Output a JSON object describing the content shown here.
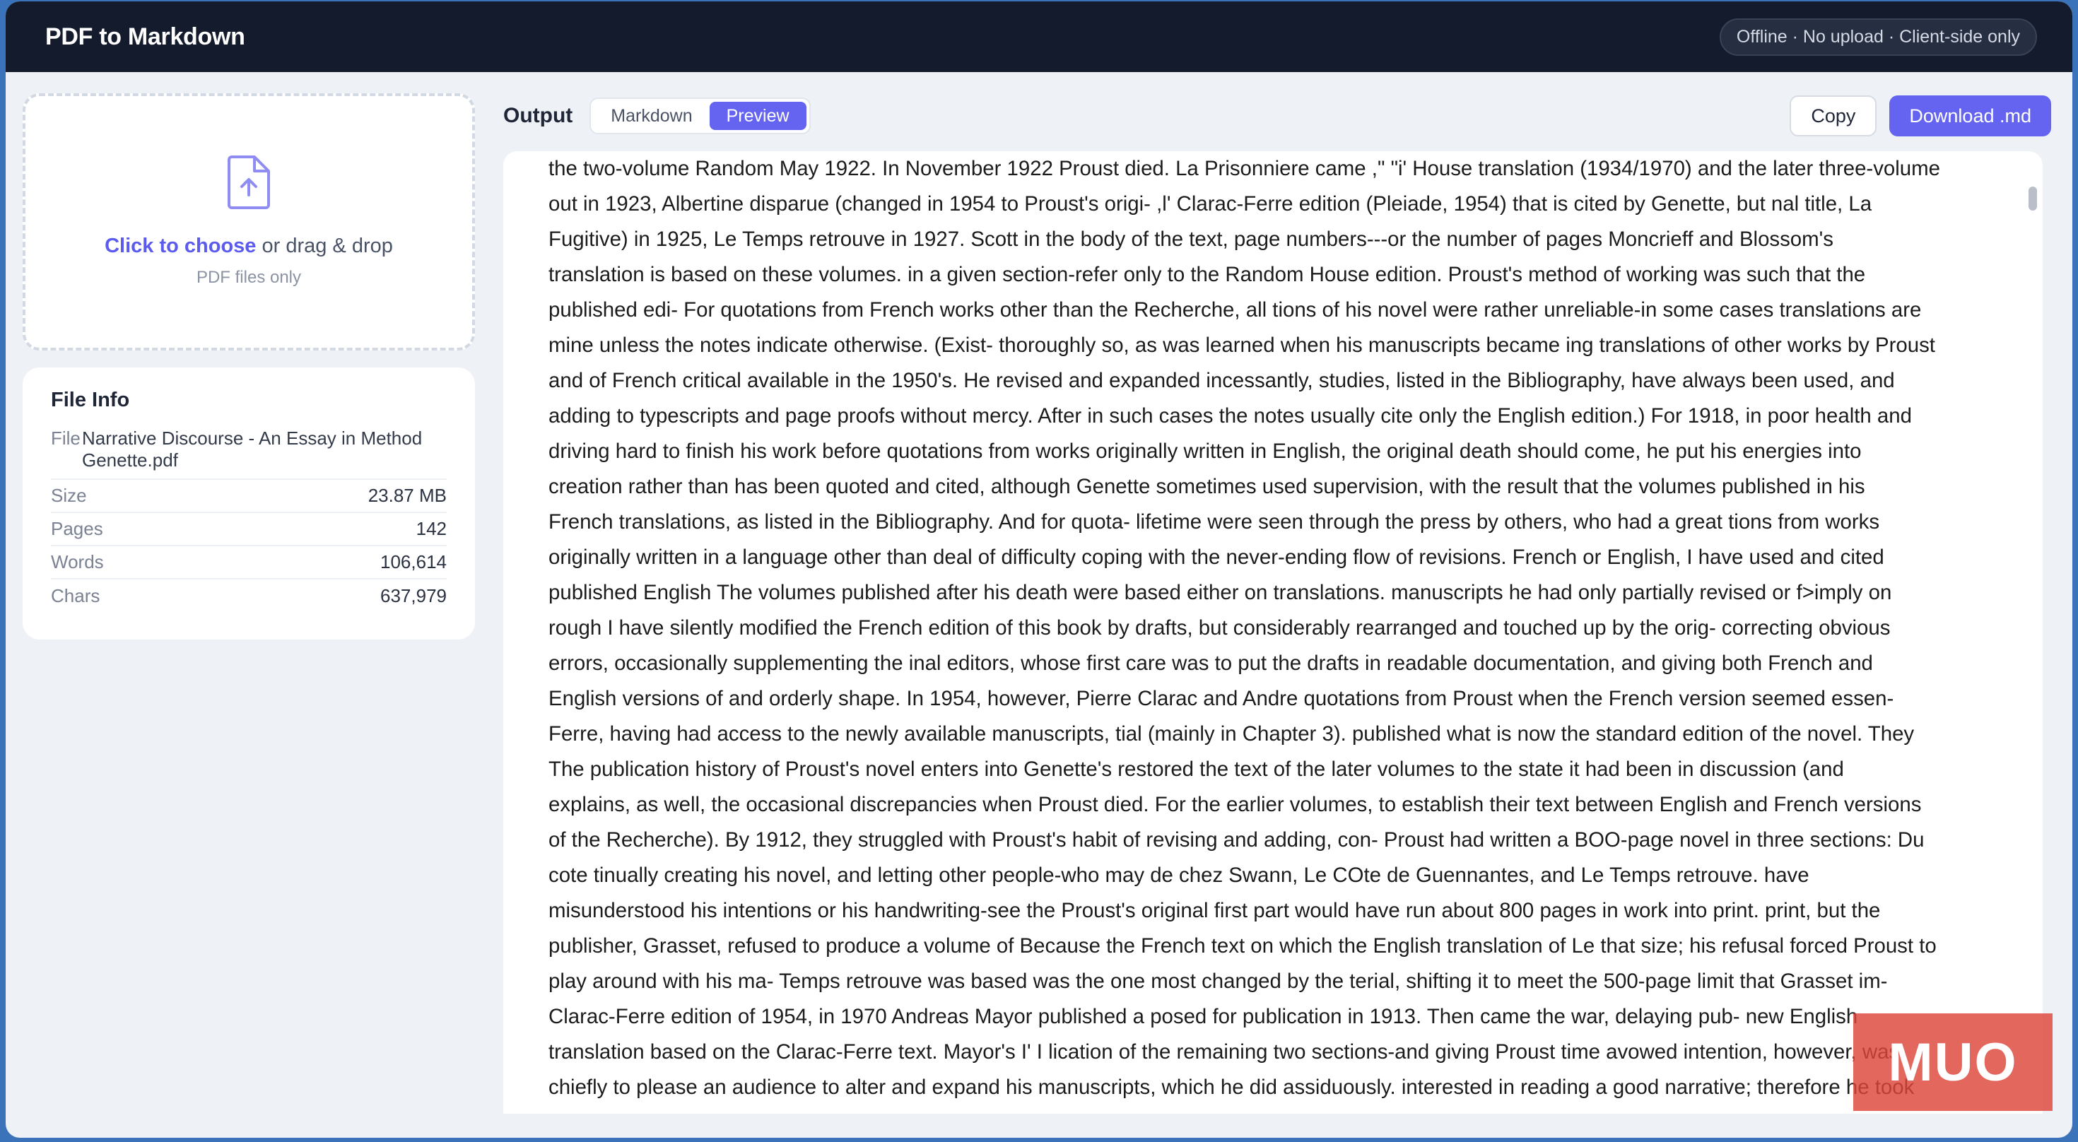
{
  "header": {
    "title": "PDF to Markdown",
    "badge": "Offline · No upload · Client-side only"
  },
  "dropzone": {
    "icon": "file-upload-icon",
    "choose_label": "Click to choose",
    "rest_label": " or drag & drop",
    "sub_label": "PDF files only"
  },
  "file_info": {
    "title": "File Info",
    "file_key": "File",
    "file_name": "Narrative Discourse - An Essay in Method Genette.pdf",
    "rows": [
      {
        "key": "Size",
        "value": "23.87 MB"
      },
      {
        "key": "Pages",
        "value": "142"
      },
      {
        "key": "Words",
        "value": "106,614"
      },
      {
        "key": "Chars",
        "value": "637,979"
      }
    ]
  },
  "output": {
    "label": "Output",
    "tabs": [
      "Markdown",
      "Preview"
    ],
    "active_tab": "Preview",
    "copy_label": "Copy",
    "download_label": "Download .md"
  },
  "preview_lines": [
    "the two-volume Random May 1922. In November 1922 Proust died. La Prisonniere came ,\" \"i' House translation (1934/1970) and the later three-volume",
    "out in 1923, Albertine disparue (changed in 1954 to Proust's origi- ,l' Clarac-Ferre edition (Pleiade, 1954) that is cited by Genette, but nal title, La",
    "Fugitive) in 1925, Le Temps retrouve in 1927. Scott in the body of the text, page numbers---or the number of pages Moncrieff and Blossom's",
    "translation is based on these volumes. in a given section-refer only to the Random House edition. Proust's method of working was such that the",
    "published edi- For quotations from French works other than the Recherche, all tions of his novel were rather unreliable-in some cases translations are",
    "mine unless the notes indicate otherwise. (Exist- thoroughly so, as was learned when his manuscripts became ing translations of other works by Proust",
    "and of French critical available in the 1950's. He revised and expanded incessantly, studies, listed in the Bibliography, have always been used, and",
    "adding to typescripts and page proofs without mercy. After in such cases the notes usually cite only the English edition.) For 1918, in poor health and",
    "driving hard to finish his work before quotations from works originally written in English, the original death should come, he put his energies into",
    "creation rather than has been quoted and cited, although Genette sometimes used supervision, with the result that the volumes published in his",
    "French translations, as listed in the Bibliography. And for quota- lifetime were seen through the press by others, who had a great tions from works",
    "originally written in a language other than deal of difficulty coping with the never-ending flow of revisions. French or English, I have used and cited",
    "published English The volumes published after his death were based either on translations. manuscripts he had only partially revised or f>imply on",
    "rough I have silently modified the French edition of this book by drafts, but considerably rearranged and touched up by the orig- correcting obvious",
    "errors, occasionally supplementing the inal editors, whose first care was to put the drafts in readable documentation, and giving both French and",
    "English versions of and orderly shape. In 1954, however, Pierre Clarac and Andre quotations from Proust when the French version seemed essen-",
    "Ferre, having had access to the newly available manuscripts, tial (mainly in Chapter 3). published what is now the standard edition of the novel. They",
    "The publication history of Proust's novel enters into Genette's restored the text of the later volumes to the state it had been in discussion (and",
    "explains, as well, the occasional discrepancies when Proust died. For the earlier volumes, to establish their text between English and French versions",
    "of the Recherche). By 1912, they struggled with Proust's habit of revising and adding, con- Proust had written a BOO-page novel in three sections: Du",
    "cote tinually creating his novel, and letting other people-who may de chez Swann, Le COte de Guennantes, and Le Temps retrouve. have",
    "misunderstood his intentions or his handwriting-see the Proust's original first part would have run about 800 pages in work into print. print, but the",
    "publisher, Grasset, refused to produce a volume of Because the French text on which the English translation of Le that size; his refusal forced Proust to",
    "play around with his ma- Temps retrouve was based was the one most changed by the terial, shifting it to meet the 500-page limit that Grasset im-",
    "Clarac-Ferre edition of 1954, in 1970 Andreas Mayor published a posed for publication in 1913. Then came the war, delaying pub- new English",
    "translation based on the Clarac-Ferre text. Mayor's I' I lication of the remaining two sections-and giving Proust time avowed intention, however, was",
    "chiefly to please an audience to alter and expand his manuscripts, which he did assiduously. interested in reading a good narrative; therefore he took"
  ],
  "watermark": "MUO"
}
